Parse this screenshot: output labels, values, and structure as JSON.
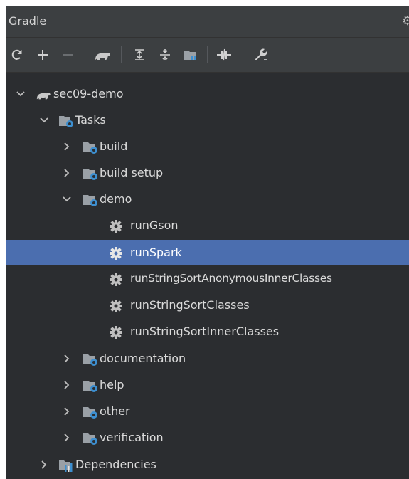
{
  "panel": {
    "title": "Gradle"
  },
  "toolbar": {
    "buttons": [
      {
        "name": "reload-icon"
      },
      {
        "name": "add-icon"
      },
      {
        "name": "remove-icon"
      },
      {
        "name": "gradle-elephant-icon"
      },
      {
        "name": "expand-all-icon"
      },
      {
        "name": "collapse-all-icon"
      },
      {
        "name": "group-modules-icon"
      },
      {
        "name": "toggle-offline-icon"
      },
      {
        "name": "wrench-settings-icon"
      }
    ]
  },
  "tree": {
    "project": "sec09-demo",
    "tasks": "Tasks",
    "build": "build",
    "build_setup": "build setup",
    "demo": "demo",
    "run_gson": "runGson",
    "run_spark": "runSpark",
    "run_anon": "runStringSortAnonymousInnerClasses",
    "run_classes": "runStringSortClasses",
    "run_inner": "runStringSortInnerClasses",
    "documentation": "documentation",
    "help": "help",
    "other": "other",
    "verification": "verification",
    "dependencies": "Dependencies"
  },
  "colors": {
    "panel_bg": "#2b2d30",
    "header_bg": "#3c3f41",
    "selection": "#4b6eaf",
    "folder_blue": "#3d8fd0",
    "gear": "#bfbfbf",
    "text": "#dadada"
  }
}
